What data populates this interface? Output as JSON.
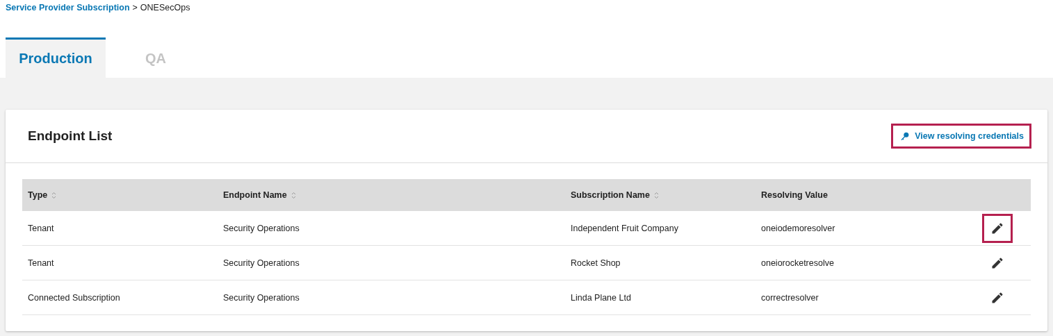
{
  "breadcrumb": {
    "link": "Service Provider Subscription",
    "separator": ">",
    "current": "ONESecOps"
  },
  "tabs": [
    {
      "label": "Production",
      "selected": true
    },
    {
      "label": "QA",
      "selected": false
    }
  ],
  "card": {
    "title": "Endpoint List",
    "credentials_link": {
      "label": "View resolving credentials",
      "highlighted": true
    }
  },
  "table": {
    "columns": [
      {
        "label": "Type",
        "sortable": true
      },
      {
        "label": "Endpoint Name",
        "sortable": true
      },
      {
        "label": "Subscription Name",
        "sortable": true
      },
      {
        "label": "Resolving Value",
        "sortable": false
      }
    ],
    "rows": [
      {
        "cells": [
          "Tenant",
          "Security Operations",
          "Independent Fruit Company",
          "oneiodemoresolver"
        ],
        "edit_highlighted": true
      },
      {
        "cells": [
          "Tenant",
          "Security Operations",
          "Rocket Shop",
          "oneiorocketresolve"
        ],
        "edit_highlighted": false
      },
      {
        "cells": [
          "Connected Subscription",
          "Security Operations",
          "Linda Plane Ltd",
          "correctresolver"
        ],
        "edit_highlighted": false
      }
    ]
  }
}
